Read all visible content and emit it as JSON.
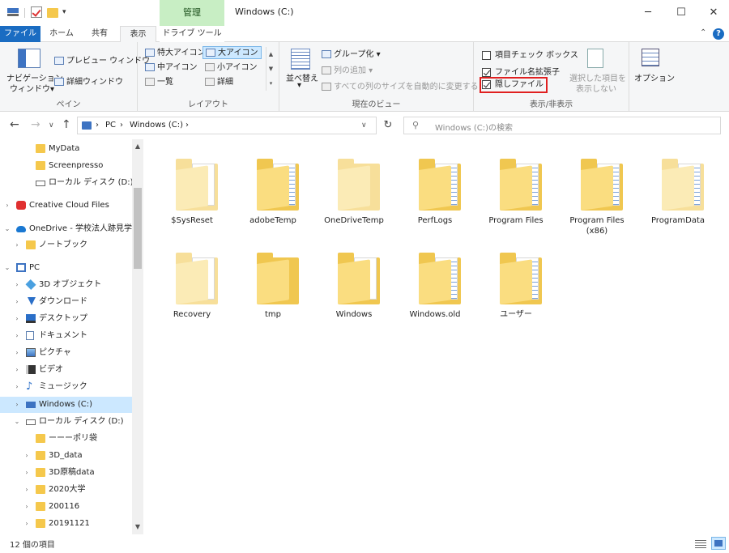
{
  "window": {
    "title": "Windows (C:)",
    "context_tab": "管理"
  },
  "tabs": {
    "file": "ファイル",
    "home": "ホーム",
    "share": "共有",
    "view": "表示",
    "drive": "ドライブ ツール"
  },
  "ribbon": {
    "pane": {
      "nav_pane_line1": "ナビゲーション",
      "nav_pane_line2": "ウィンドウ▾",
      "preview": "プレビュー ウィンドウ",
      "details": "詳細ウィンドウ",
      "label": "ペイン"
    },
    "layout": {
      "extra_large": "特大アイコン",
      "large": "大アイコン",
      "medium": "中アイコン",
      "small": "小アイコン",
      "list": "一覧",
      "details": "詳細",
      "label": "レイアウト"
    },
    "view": {
      "sort_line1": "並べ替え",
      "sort_line2": "▾",
      "group": "グループ化 ▾",
      "add_column": "列の追加 ▾",
      "autosize": "すべての列のサイズを自動的に変更する",
      "label": "現在のビュー"
    },
    "show": {
      "item_checkboxes": "項目チェック ボックス",
      "file_extensions": "ファイル名拡張子",
      "hidden_items": "隠しファイル",
      "hide_selected_line1": "選択した項目を",
      "hide_selected_line2": "表示しない",
      "label": "表示/非表示"
    },
    "options": {
      "label": "オプション"
    }
  },
  "address": {
    "crumbs": [
      "PC",
      "Windows (C:)"
    ],
    "search_placeholder": "Windows (C:)の検索"
  },
  "nav": [
    {
      "label": "MyData",
      "icon": "folder",
      "arrow": ""
    },
    {
      "label": "Screenpresso",
      "icon": "folder",
      "arrow": ""
    },
    {
      "label": "ローカル ディスク (D:)",
      "icon": "drive",
      "arrow": ""
    },
    {
      "label": "Creative Cloud Files",
      "icon": "cc",
      "arrow": ">"
    },
    {
      "label": "OneDrive - 学校法人跡見学",
      "icon": "cloud",
      "arrow": "v"
    },
    {
      "label": "ノートブック",
      "icon": "folder",
      "arrow": ">"
    },
    {
      "label": "PC",
      "icon": "pc",
      "arrow": "v"
    },
    {
      "label": "3D オブジェクト",
      "icon": "3d",
      "arrow": ">"
    },
    {
      "label": "ダウンロード",
      "icon": "down",
      "arrow": ">"
    },
    {
      "label": "デスクトップ",
      "icon": "desk",
      "arrow": ">"
    },
    {
      "label": "ドキュメント",
      "icon": "doc",
      "arrow": ">"
    },
    {
      "label": "ピクチャ",
      "icon": "pic",
      "arrow": ">"
    },
    {
      "label": "ビデオ",
      "icon": "vid",
      "arrow": ">"
    },
    {
      "label": "ミュージック",
      "icon": "music",
      "arrow": ">"
    },
    {
      "label": "Windows (C:)",
      "icon": "drive-c",
      "arrow": ">"
    },
    {
      "label": "ローカル ディスク (D:)",
      "icon": "drive",
      "arrow": "v"
    },
    {
      "label": "ーーーポリ袋",
      "icon": "folder",
      "arrow": ""
    },
    {
      "label": "3D_data",
      "icon": "folder",
      "arrow": ">"
    },
    {
      "label": "3D原稿data",
      "icon": "folder",
      "arrow": ">"
    },
    {
      "label": "2020大学",
      "icon": "folder",
      "arrow": ">"
    },
    {
      "label": "200116",
      "icon": "folder",
      "arrow": ">"
    },
    {
      "label": "20191121",
      "icon": "folder",
      "arrow": ">"
    }
  ],
  "files": [
    {
      "name": "$SysReset",
      "style": "pale-paper"
    },
    {
      "name": "adobeTemp",
      "style": "lines"
    },
    {
      "name": "OneDriveTemp",
      "style": "pale"
    },
    {
      "name": "PerfLogs",
      "style": "lines"
    },
    {
      "name": "Program Files",
      "style": "lines"
    },
    {
      "name": "Program Files\n(x86)",
      "style": "lines"
    },
    {
      "name": "ProgramData",
      "style": "lines-pale"
    },
    {
      "name": "Recovery",
      "style": "pale-paper"
    },
    {
      "name": "tmp",
      "style": "plain"
    },
    {
      "name": "Windows",
      "style": "paper"
    },
    {
      "name": "Windows.old",
      "style": "lines"
    },
    {
      "name": "ユーザー",
      "style": "lines"
    }
  ],
  "status": {
    "count": "12 個の項目"
  }
}
